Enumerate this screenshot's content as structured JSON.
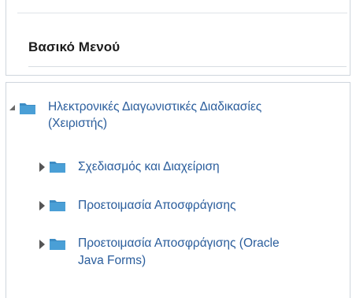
{
  "menu": {
    "title": "Βασικό Μενού"
  },
  "tree": {
    "root": {
      "label_line1": "Ηλεκτρονικές Διαγωνιστικές Διαδικασίες",
      "label_line2": "(Χειριστής)",
      "expanded": true
    },
    "children": [
      {
        "label_line1": "Σχεδιασμός και Διαχείριση",
        "label_line2": "",
        "expanded": false
      },
      {
        "label_line1": "Προετοιμασία Αποσφράγισης",
        "label_line2": "",
        "expanded": false
      },
      {
        "label_line1": "Προετοιμασία Αποσφράγισης (Oracle",
        "label_line2": "Java Forms)",
        "expanded": false
      }
    ]
  },
  "colors": {
    "link": "#2a5d9c",
    "folder_fill": "#4a9fd6",
    "folder_tab": "#3d8cc4"
  },
  "icons": {
    "folder": "folder-icon",
    "expanded": "triangle-down-icon",
    "collapsed": "triangle-right-icon"
  }
}
